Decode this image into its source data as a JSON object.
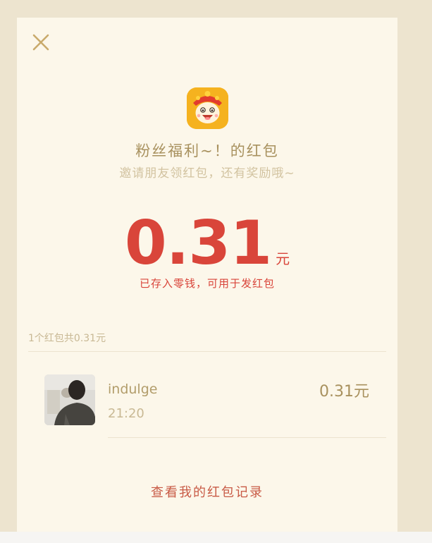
{
  "header": {
    "close_icon": "close-icon"
  },
  "app": {
    "icon": "mascot-app-icon"
  },
  "packet": {
    "title": "粉丝福利~！的红包",
    "subtitle": "邀请朋友领红包，还有奖励哦~",
    "amount": "0.31",
    "unit": "元",
    "note": "已存入零钱，可用于发红包"
  },
  "summary": {
    "text": "1个红包共0.31元"
  },
  "records": [
    {
      "name": "indulge",
      "time": "21:20",
      "amount": "0.31元"
    }
  ],
  "footer": {
    "link": "查看我的红包记录"
  },
  "colors": {
    "page_bg": "#ede4cf",
    "panel_bg": "#fcf7ea",
    "accent_red": "#d9453a",
    "gold": "#a8915e"
  }
}
